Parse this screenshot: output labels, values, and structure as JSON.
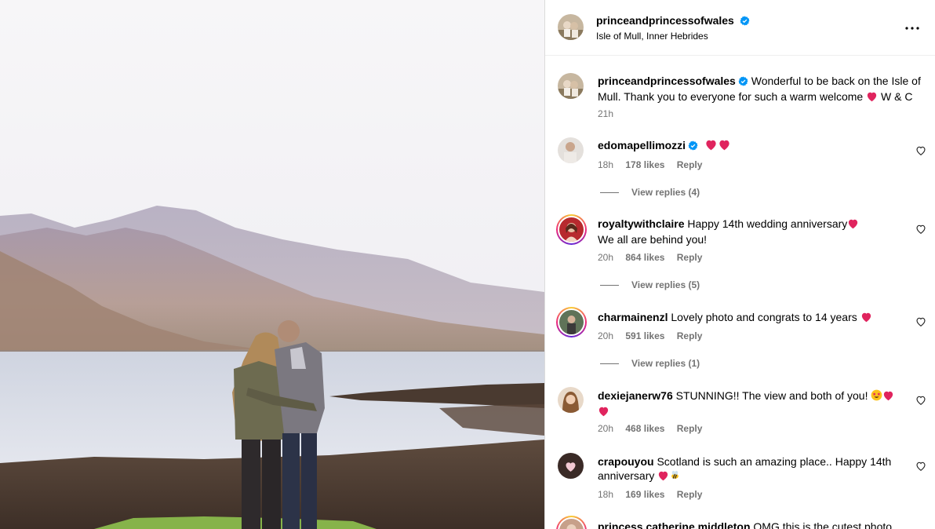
{
  "post": {
    "image_alt": "Couple embracing on a lochside shore facing misty mountains",
    "author": {
      "username": "princeandprincessofwales",
      "location": "Isle of Mull, Inner Hebrides",
      "verified": true
    },
    "caption": {
      "username": "princeandprincessofwales",
      "text_before": "Wonderful to be back on the Isle of Mull. Thank you to everyone for such a warm welcome",
      "text_after": "W & C",
      "time": "21h"
    }
  },
  "comments": [
    {
      "username": "edomapellimozzi",
      "text": "",
      "time": "18h",
      "likes": "178 likes",
      "reply_label": "Reply",
      "view_replies": "View replies (4)"
    },
    {
      "username": "royaltywithclaire",
      "text": "Happy 14th wedding anniversary",
      "text_line2": "We all are behind you!",
      "time": "20h",
      "likes": "864 likes",
      "reply_label": "Reply",
      "view_replies": "View replies (5)"
    },
    {
      "username": "charmainenzl",
      "text": "Lovely photo and congrats to 14 years",
      "time": "20h",
      "likes": "591 likes",
      "reply_label": "Reply",
      "view_replies": "View replies (1)"
    },
    {
      "username": "dexiejanerw76",
      "text": "STUNNING!! The view and both of you!",
      "time": "20h",
      "likes": "468 likes",
      "reply_label": "Reply"
    },
    {
      "username": "crapouyou",
      "text": "Scotland is such an amazing place.. Happy 14th anniversary",
      "time": "18h",
      "likes": "169 likes",
      "reply_label": "Reply"
    },
    {
      "username": "princess.catherine.middleton",
      "text": "OMG this is the cutest photo"
    }
  ],
  "icons": {
    "more": "more-options-icon",
    "verified": "verified-badge-icon",
    "like": "heart-outline-icon"
  },
  "colors": {
    "verified_blue": "#0095f6",
    "heart_red": "#e0245e",
    "muted_text": "#737373"
  }
}
